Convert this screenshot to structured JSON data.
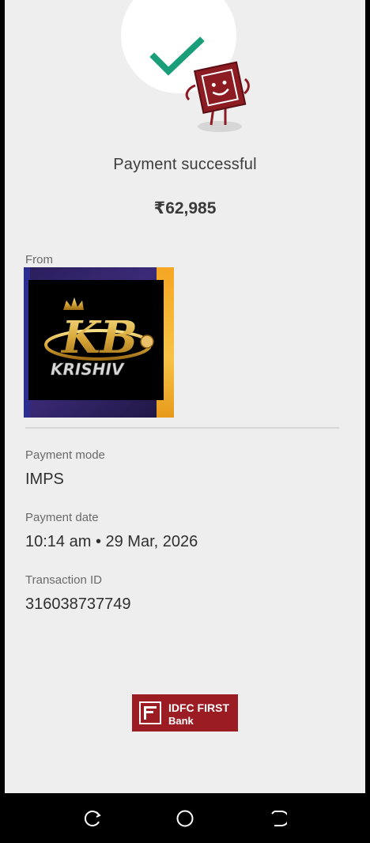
{
  "status": {
    "text": "Payment successful",
    "icon": "check-mark-icon",
    "mascot": "smiling-card-mascot-icon"
  },
  "amount": "₹62,985",
  "from": {
    "label": "From",
    "logo": {
      "brand_text": "KRISHIV",
      "monogram": "KB"
    }
  },
  "details": {
    "payment_mode": {
      "label": "Payment mode",
      "value": "IMPS"
    },
    "payment_date": {
      "label": "Payment date",
      "value": "10:14 am • 29 Mar, 2026"
    },
    "transaction_id": {
      "label": "Transaction ID",
      "value": "316038737749"
    }
  },
  "bank": {
    "line1": "IDFC FIRST",
    "line2": "Bank",
    "color": "#9b1c22"
  },
  "navbar": {
    "recent": "recent-apps-icon",
    "home": "home-icon",
    "back": "back-icon"
  },
  "colors": {
    "background": "#eeeeee",
    "check": "#1a9e7a",
    "mascot": "#8c1b22"
  }
}
